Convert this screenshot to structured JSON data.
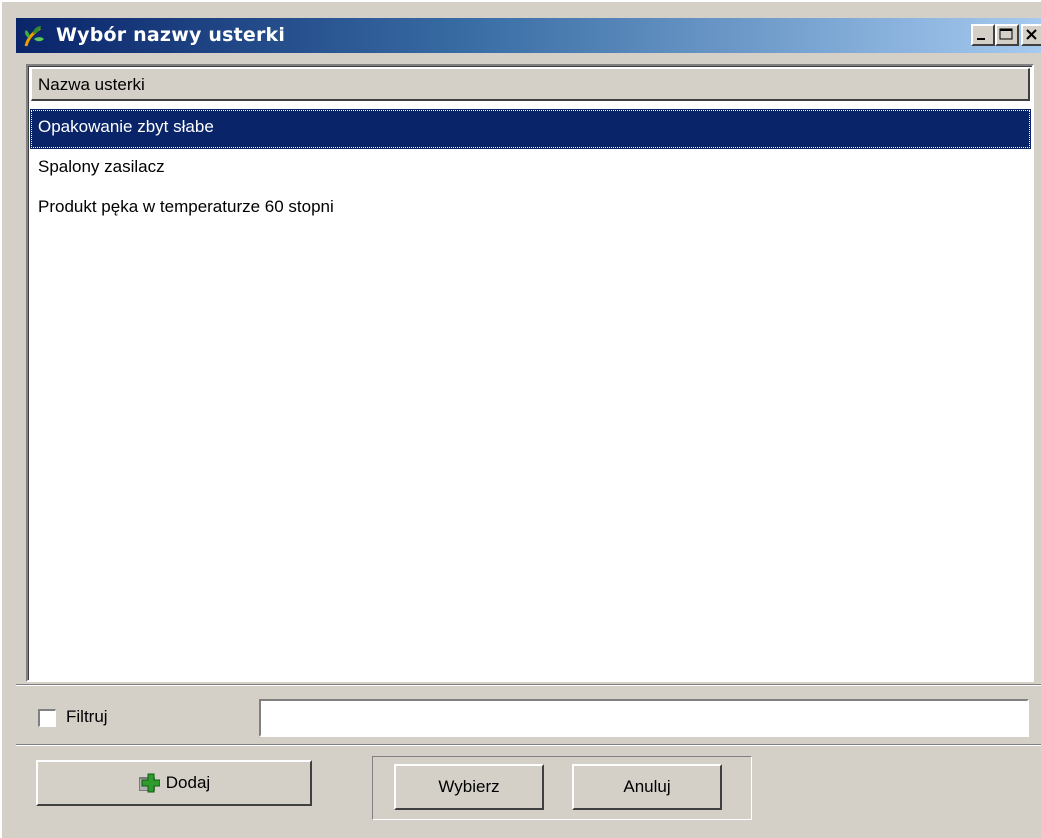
{
  "window": {
    "title": "Wybór nazwy usterki",
    "icons": {
      "app": "app-plant-icon",
      "minimize": "minimize-icon",
      "maximize": "maximize-icon",
      "close": "close-icon"
    }
  },
  "list": {
    "column_header": "Nazwa usterki",
    "items": [
      {
        "label": "Opakowanie zbyt słabe",
        "selected": true
      },
      {
        "label": "Spalony zasilacz",
        "selected": false
      },
      {
        "label": "Produkt pęka w temperaturze 60 stopni",
        "selected": false
      }
    ]
  },
  "filter": {
    "checkbox_label": "Filtruj",
    "checked": false,
    "input_value": ""
  },
  "buttons": {
    "add": "Dodaj",
    "select": "Wybierz",
    "cancel": "Anuluj",
    "add_icon": "plus-icon"
  },
  "colors": {
    "selection": "#0a246a",
    "face": "#d4d0c8",
    "title_start": "#0a246a",
    "title_end": "#a6caf0",
    "plus_icon": "#2e9b2e"
  }
}
